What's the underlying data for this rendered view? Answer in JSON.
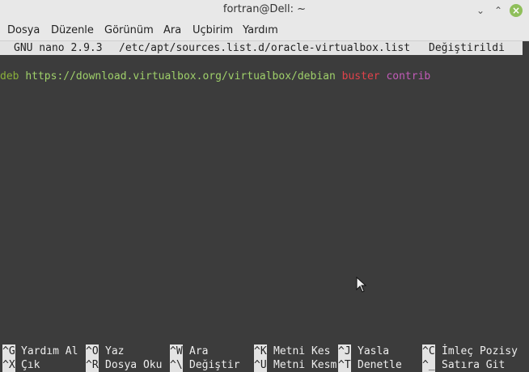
{
  "window": {
    "title": "fortran@Dell: ~"
  },
  "menubar": [
    "Dosya",
    "Düzenle",
    "Görünüm",
    "Ara",
    "Uçbirim",
    "Yardım"
  ],
  "nano": {
    "version": "GNU nano 2.9.3",
    "file": "/etc/apt/sources.list.d/oracle-virtualbox.list",
    "status": "Değiştirildi"
  },
  "content": {
    "deb": "deb",
    "url": "https://download.virtualbox.org/virtualbox/debian",
    "dist": "buster",
    "component": "contrib"
  },
  "shortcuts": {
    "row1": [
      {
        "key": "^G",
        "label": "Yardım Al"
      },
      {
        "key": "^O",
        "label": "Yaz"
      },
      {
        "key": "^W",
        "label": "Ara"
      },
      {
        "key": "^K",
        "label": "Metni Kes"
      },
      {
        "key": "^J",
        "label": "Yasla"
      },
      {
        "key": "^C",
        "label": "İmleç Pozisy"
      }
    ],
    "row2": [
      {
        "key": "^X",
        "label": "Çık"
      },
      {
        "key": "^R",
        "label": "Dosya Oku"
      },
      {
        "key": "^\\",
        "label": "Değiştir"
      },
      {
        "key": "^U",
        "label": "Metni Kesm"
      },
      {
        "key": "^T",
        "label": "Denetle"
      },
      {
        "key": "^_",
        "label": "Satıra Git"
      }
    ]
  },
  "colors": {
    "deb": "#8ab03a",
    "url": "#9fd06a",
    "dist": "#e0424a",
    "component": "#c25bb8"
  }
}
